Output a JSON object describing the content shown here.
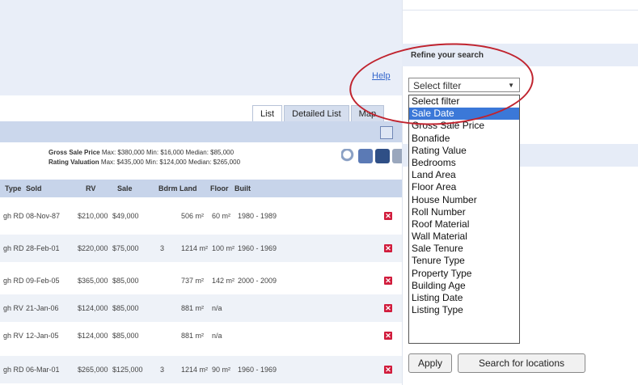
{
  "help_label": "Help",
  "tabs": [
    {
      "label": "List",
      "active": true
    },
    {
      "label": "Detailed List",
      "active": false
    },
    {
      "label": "Map",
      "active": false
    }
  ],
  "stats": {
    "gross_label": "Gross Sale Price",
    "gross_values": "Max: $380,000 Min: $16,000  Median: $85,000",
    "rating_label": "Rating Valuation",
    "rating_values": "Max: $435,000 Min: $124,000 Median: $265,000"
  },
  "table": {
    "columns": [
      "Type",
      "Sold",
      "RV",
      "Sale",
      "Bdrm",
      "Land",
      "Floor",
      "Built"
    ],
    "rows": [
      {
        "prefix": "gh RD",
        "sold": "08-Nov-87",
        "rv": "$210,000",
        "sale": "$49,000",
        "bdrm": "",
        "land": "506 m²",
        "floor": "60 m²",
        "built": "1980 - 1989"
      },
      {
        "prefix": "gh RD",
        "sold": "28-Feb-01",
        "rv": "$220,000",
        "sale": "$75,000",
        "bdrm": "3",
        "land": "1214 m²",
        "floor": "100 m²",
        "built": "1960 - 1969"
      },
      {
        "prefix": "gh RD",
        "sold": "09-Feb-05",
        "rv": "$365,000",
        "sale": "$85,000",
        "bdrm": "",
        "land": "737 m²",
        "floor": "142 m²",
        "built": "2000 - 2009"
      },
      {
        "prefix": "gh RV",
        "sold": "21-Jan-06",
        "rv": "$124,000",
        "sale": "$85,000",
        "bdrm": "",
        "land": "881 m²",
        "floor": "n/a",
        "built": ""
      },
      {
        "prefix": "gh RV",
        "sold": "12-Jan-05",
        "rv": "$124,000",
        "sale": "$85,000",
        "bdrm": "",
        "land": "881 m²",
        "floor": "n/a",
        "built": ""
      },
      {
        "prefix": "gh RD",
        "sold": "06-Mar-01",
        "rv": "$265,000",
        "sale": "$125,000",
        "bdrm": "3",
        "land": "1214 m²",
        "floor": "90 m²",
        "built": "1960 - 1969"
      }
    ],
    "delete_glyph": "✕"
  },
  "refine": {
    "title": "Refine your search",
    "select_value": "Select filter",
    "options": [
      "Select filter",
      "Sale Date",
      "Gross Sale Price",
      "Bonafide",
      "Rating Value",
      "Bedrooms",
      "Land Area",
      "Floor Area",
      "House Number",
      "Roll Number",
      "Roof Material",
      "Wall Material",
      "Sale Tenure",
      "Tenure Type",
      "Property Type",
      "Building Age",
      "Listing Date",
      "Listing Type"
    ],
    "highlighted_option": "Sale Date",
    "apply_label": "Apply",
    "search_label": "Search for locations"
  },
  "colors": {
    "annotation_circle": "#c0232e",
    "highlight": "#3b78d8",
    "delete_icon": "#d11c3c"
  }
}
